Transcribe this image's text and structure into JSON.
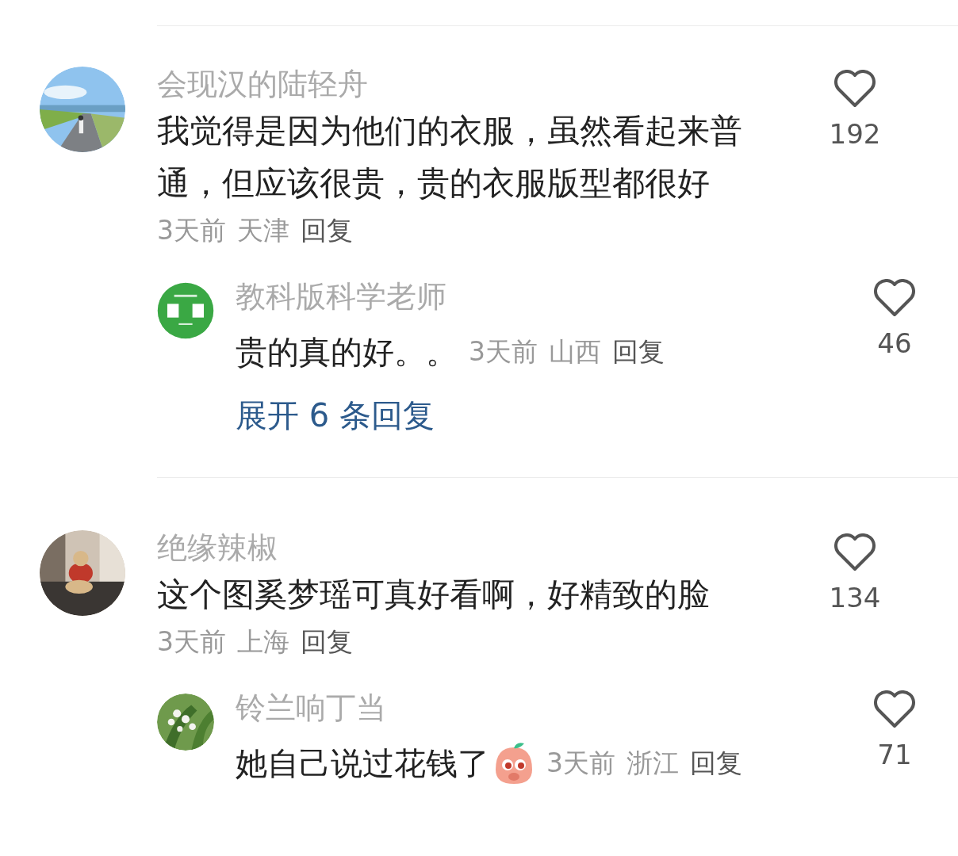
{
  "comments": [
    {
      "user": "会现汉的陆轻舟",
      "text": "我觉得是因为他们的衣服，虽然看起来普通，但应该很贵，贵的衣服版型都很好",
      "time": "3天前",
      "location": "天津",
      "reply_label": "回复",
      "likes": "192",
      "replies": [
        {
          "user": "教科版科学老师",
          "text": "贵的真的好。。",
          "emoji": false,
          "time": "3天前",
          "location": "山西",
          "reply_label": "回复",
          "likes": "46"
        }
      ],
      "expand_label": "展开 6 条回复"
    },
    {
      "user": "绝缘辣椒",
      "text": "这个图奚梦瑶可真好看啊，好精致的脸",
      "time": "3天前",
      "location": "上海",
      "reply_label": "回复",
      "likes": "134",
      "replies": [
        {
          "user": "铃兰响丁当",
          "text": "她自己说过花钱了",
          "emoji": true,
          "time": "3天前",
          "location": "浙江",
          "reply_label": "回复",
          "likes": "71"
        }
      ]
    }
  ]
}
